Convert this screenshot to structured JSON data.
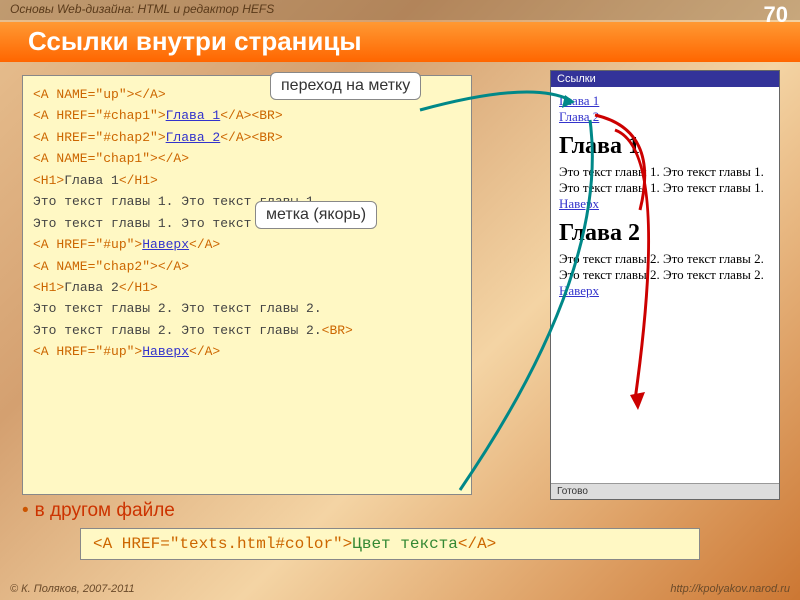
{
  "header": {
    "left": "Основы Web-дизайна: HTML и редактор HEFS",
    "pageNumber": "70"
  },
  "title": "Ссылки внутри страницы",
  "callouts": {
    "c1": "переход на метку",
    "c2": "метка (якорь)"
  },
  "code": {
    "l1a": "<A NAME=\"up\">",
    "l1b": "</A>",
    "l2a": "<A HREF=\"#chap1\">",
    "l2b": "Глава 1",
    "l2c": "</A><BR>",
    "l3a": "<A HREF=\"#chap2\">",
    "l3b": "Глава 2",
    "l3c": "</A><BR>",
    "l4a": "<A NAME=\"chap1\">",
    "l4b": "</A>",
    "l5a": "<H1>",
    "l5b": "Глава 1",
    "l5c": "</H1>",
    "l6": "Это текст главы 1. Это текст главы 1.",
    "l7": "Это текст главы 1. Это текст главы 1.",
    "l7b": "<BR>",
    "l8a": "<A HREF=\"#up\">",
    "l8b": "Наверх",
    "l8c": "</A>",
    "l9a": "<A NAME=\"chap2\">",
    "l9b": "</A>",
    "l10a": "<H1>",
    "l10b": "Глава 2",
    "l10c": "</H1>",
    "l11": "Это текст главы 2. Это текст главы 2.",
    "l12": "Это текст главы 2. Это текст главы 2.",
    "l12b": "<BR>",
    "l13a": "<A HREF=\"#up\">",
    "l13b": "Наверх",
    "l13c": "</A>"
  },
  "preview": {
    "title": "Ссылки",
    "link1": "Глава 1",
    "link2": "Глава 2",
    "h1": "Глава 1",
    "p1": "Это текст главы 1. Это текст главы 1. Это текст главы 1. Это текст главы 1.",
    "navUp1": "Наверх",
    "h2": "Глава 2",
    "p2": "Это текст главы 2. Это текст главы 2. Это текст главы 2. Это текст главы 2.",
    "navUp2": "Наверх",
    "status": "Готово"
  },
  "bullet": "в другом файле",
  "code2": {
    "a": "<A HREF=\"texts.html#color\">",
    "b": "Цвет текста",
    "c": "</A>"
  },
  "footer": {
    "left": "© К. Поляков, 2007-2011",
    "right": "http://kpolyakov.narod.ru"
  }
}
